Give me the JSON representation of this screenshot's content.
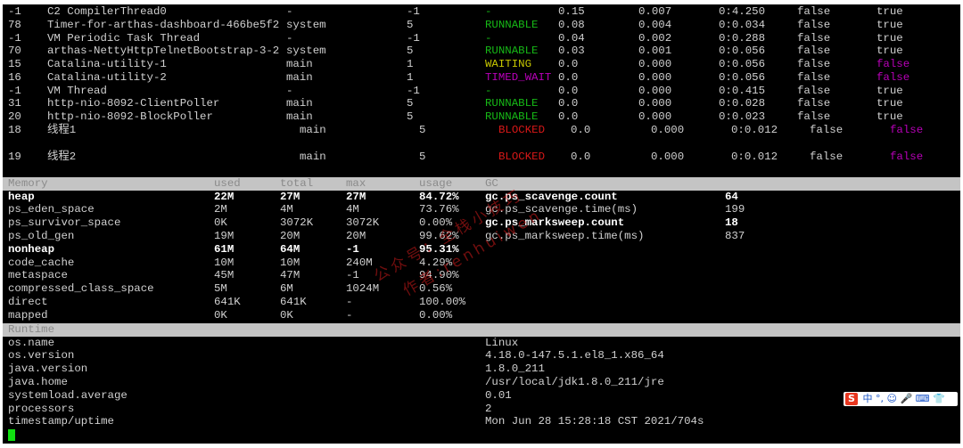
{
  "threads": [
    {
      "id": "-1",
      "name": "C2 CompilerThread0",
      "group": "-",
      "priority": "-1",
      "state": "-",
      "cpu": "0.15",
      "delta_time": "0.007",
      "time": "0:4.250",
      "interrupted": "false",
      "daemon": "true",
      "state_color": "#16b816",
      "daemon_color": "#d0d0d0"
    },
    {
      "id": "78",
      "name": "Timer-for-arthas-dashboard-466be5f2",
      "group": "system",
      "priority": "5",
      "state": "RUNNABLE",
      "cpu": "0.08",
      "delta_time": "0.004",
      "time": "0:0.034",
      "interrupted": "false",
      "daemon": "true",
      "state_color": "#16b816",
      "daemon_color": "#d0d0d0"
    },
    {
      "id": "-1",
      "name": "VM Periodic Task Thread",
      "group": "-",
      "priority": "-1",
      "state": "-",
      "cpu": "0.04",
      "delta_time": "0.002",
      "time": "0:0.288",
      "interrupted": "false",
      "daemon": "true",
      "state_color": "#16b816",
      "daemon_color": "#d0d0d0"
    },
    {
      "id": "70",
      "name": "arthas-NettyHttpTelnetBootstrap-3-2",
      "group": "system",
      "priority": "5",
      "state": "RUNNABLE",
      "cpu": "0.03",
      "delta_time": "0.001",
      "time": "0:0.056",
      "interrupted": "false",
      "daemon": "true",
      "state_color": "#16b816",
      "daemon_color": "#d0d0d0"
    },
    {
      "id": "15",
      "name": "Catalina-utility-1",
      "group": "main",
      "priority": "1",
      "state": "WAITING",
      "cpu": "0.0",
      "delta_time": "0.000",
      "time": "0:0.056",
      "interrupted": "false",
      "daemon": "false",
      "state_color": "#c8c800",
      "daemon_color": "#b800b8"
    },
    {
      "id": "16",
      "name": "Catalina-utility-2",
      "group": "main",
      "priority": "1",
      "state": "TIMED_WAIT",
      "cpu": "0.0",
      "delta_time": "0.000",
      "time": "0:0.056",
      "interrupted": "false",
      "daemon": "false",
      "state_color": "#b800b8",
      "daemon_color": "#b800b8"
    },
    {
      "id": "-1",
      "name": "VM Thread",
      "group": "-",
      "priority": "-1",
      "state": "-",
      "cpu": "0.0",
      "delta_time": "0.000",
      "time": "0:0.415",
      "interrupted": "false",
      "daemon": "true",
      "state_color": "#16b816",
      "daemon_color": "#d0d0d0"
    },
    {
      "id": "31",
      "name": "http-nio-8092-ClientPoller",
      "group": "main",
      "priority": "5",
      "state": "RUNNABLE",
      "cpu": "0.0",
      "delta_time": "0.000",
      "time": "0:0.028",
      "interrupted": "false",
      "daemon": "true",
      "state_color": "#16b816",
      "daemon_color": "#d0d0d0"
    },
    {
      "id": "20",
      "name": "http-nio-8092-BlockPoller",
      "group": "main",
      "priority": "5",
      "state": "RUNNABLE",
      "cpu": "0.0",
      "delta_time": "0.000",
      "time": "0:0.023",
      "interrupted": "false",
      "daemon": "true",
      "state_color": "#16b816",
      "daemon_color": "#d0d0d0"
    }
  ],
  "blocked_threads": [
    {
      "id": "18",
      "name": "线程1",
      "group": "main",
      "priority": "5",
      "state": "BLOCKED",
      "cpu": "0.0",
      "delta_time": "0.000",
      "time": "0:0.012",
      "interrupted": "false",
      "daemon": "false"
    },
    {
      "id": "19",
      "name": "线程2",
      "group": "main",
      "priority": "5",
      "state": "BLOCKED",
      "cpu": "0.0",
      "delta_time": "0.000",
      "time": "0:0.012",
      "interrupted": "false",
      "daemon": "false"
    }
  ],
  "memory_header": {
    "memory": "Memory",
    "used": "used",
    "total": "total",
    "max": "max",
    "usage": "usage",
    "gc": "GC"
  },
  "memory": [
    {
      "name": "heap",
      "used": "22M",
      "total": "27M",
      "max": "27M",
      "usage": "84.72%",
      "bold": true
    },
    {
      "name": "ps_eden_space",
      "used": "2M",
      "total": "4M",
      "max": "4M",
      "usage": "73.76%",
      "bold": false
    },
    {
      "name": "ps_survivor_space",
      "used": "0K",
      "total": "3072K",
      "max": "3072K",
      "usage": "0.00%",
      "bold": false
    },
    {
      "name": "ps_old_gen",
      "used": "19M",
      "total": "20M",
      "max": "20M",
      "usage": "99.62%",
      "bold": false
    },
    {
      "name": "nonheap",
      "used": "61M",
      "total": "64M",
      "max": "-1",
      "usage": "95.31%",
      "bold": true
    },
    {
      "name": "code_cache",
      "used": "10M",
      "total": "10M",
      "max": "240M",
      "usage": "4.29%",
      "bold": false
    },
    {
      "name": "metaspace",
      "used": "45M",
      "total": "47M",
      "max": "-1",
      "usage": "94.90%",
      "bold": false
    },
    {
      "name": "compressed_class_space",
      "used": "5M",
      "total": "6M",
      "max": "1024M",
      "usage": "0.56%",
      "bold": false
    },
    {
      "name": "direct",
      "used": "641K",
      "total": "641K",
      "max": "-",
      "usage": "100.00%",
      "bold": false
    },
    {
      "name": "mapped",
      "used": "0K",
      "total": "0K",
      "max": "-",
      "usage": "0.00%",
      "bold": false
    }
  ],
  "gc": [
    {
      "name": "gc.ps_scavenge.count",
      "value": "64",
      "bold": true
    },
    {
      "name": "gc.ps_scavenge.time(ms)",
      "value": "199",
      "bold": false
    },
    {
      "name": "gc.ps_marksweep.count",
      "value": "18",
      "bold": true
    },
    {
      "name": "gc.ps_marksweep.time(ms)",
      "value": "837",
      "bold": false
    }
  ],
  "runtime_header": "Runtime",
  "runtime": [
    {
      "name": "os.name",
      "value": "Linux"
    },
    {
      "name": "os.version",
      "value": "4.18.0-147.5.1.el8_1.x86_64"
    },
    {
      "name": "java.version",
      "value": "1.8.0_211"
    },
    {
      "name": "java.home",
      "value": "/usr/local/jdk1.8.0_211/jre"
    },
    {
      "name": "systemload.average",
      "value": "0.01"
    },
    {
      "name": "processors",
      "value": "2"
    },
    {
      "name": "timestamp/uptime",
      "value": "Mon Jun 28 15:28:18 CST 2021/704s"
    }
  ],
  "watermark": {
    "line1": "公众号：全栈小技巧",
    "line2": "作者:renhuiwen"
  },
  "ime": {
    "logo": "S",
    "text": "中 °, ☺ 🎤 ⌨ 👕"
  },
  "colors": {
    "green": "#16b816",
    "yellow": "#c8c800",
    "magenta": "#b800b8",
    "red": "#d81818",
    "header_bg": "#c4c4c4"
  }
}
